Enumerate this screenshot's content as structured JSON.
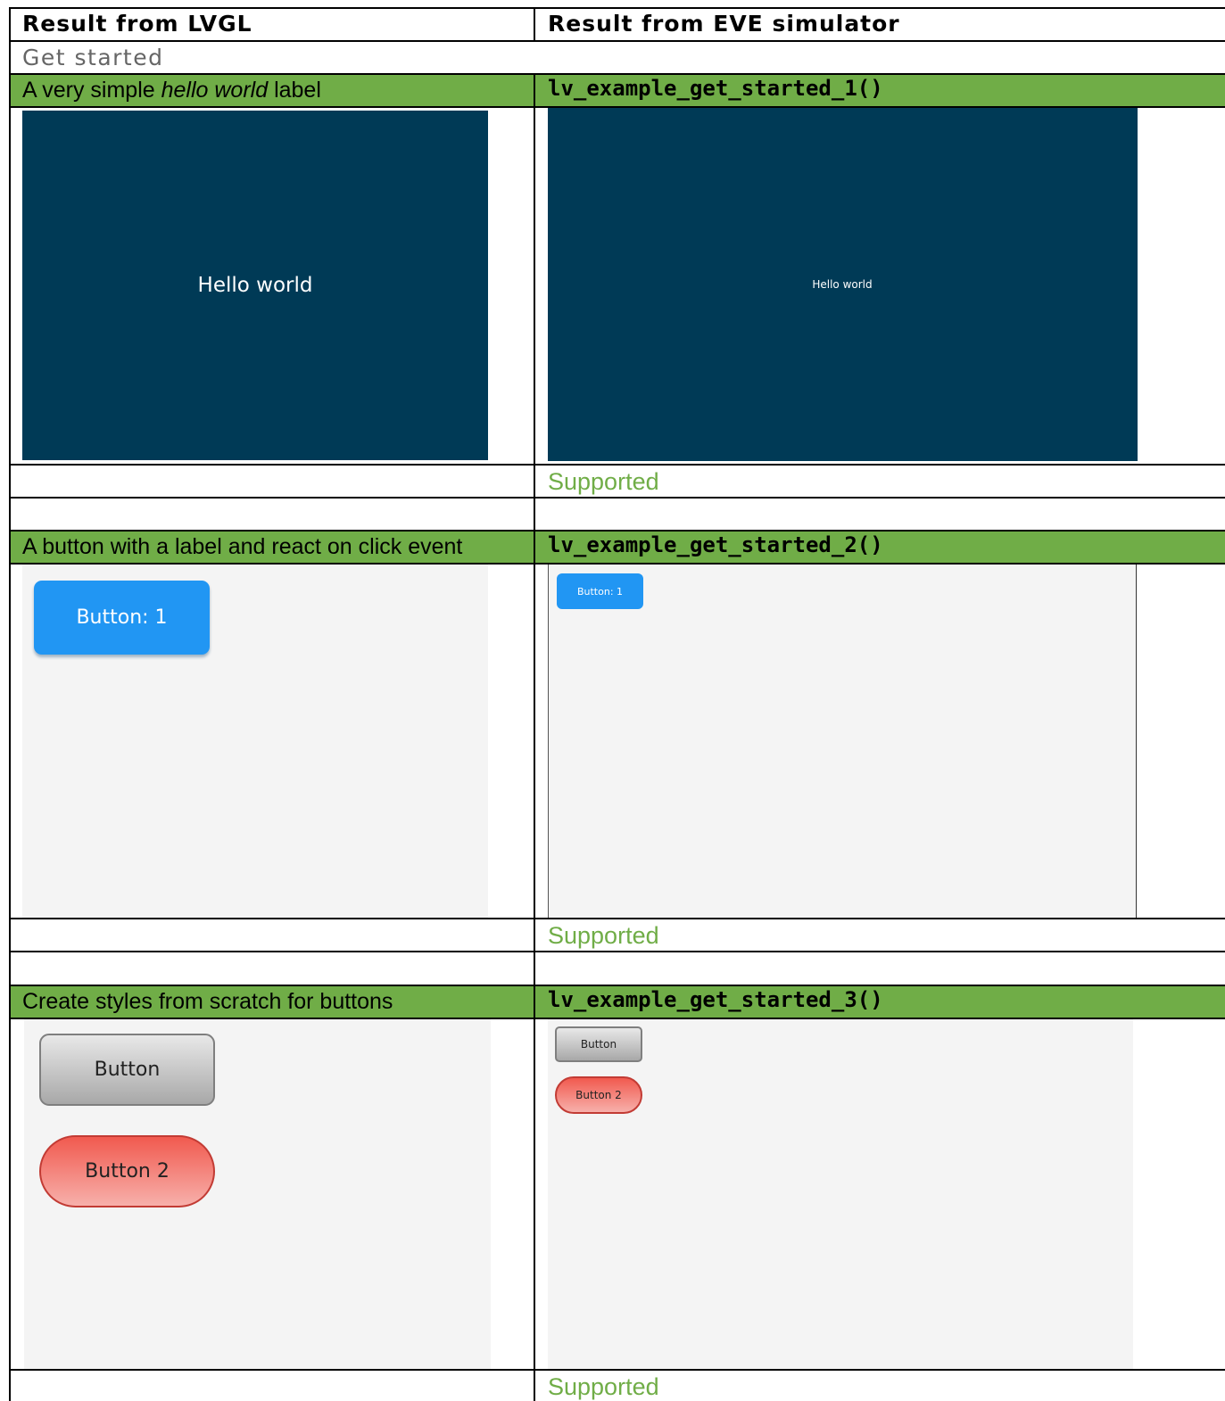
{
  "header": {
    "col_left": "Result from LVGL",
    "col_right": "Result from EVE simulator"
  },
  "section": {
    "title": "Get started"
  },
  "examples": [
    {
      "desc_pre": "A very simple ",
      "desc_em": "hello world",
      "desc_post": " label",
      "code": "lv_example_get_started_1()",
      "lvgl_label": "Hello world",
      "eve_label": "Hello world",
      "status": "Supported",
      "colors": {
        "background": "#003a56"
      }
    },
    {
      "desc": "A button with a label and react on click event",
      "code": "lv_example_get_started_2()",
      "lvgl_button": "Button: 1",
      "eve_button": "Button: 1",
      "status": "Supported",
      "colors": {
        "button": "#2196f3",
        "background": "#f4f4f4"
      }
    },
    {
      "desc": "Create styles from scratch for buttons",
      "code": "lv_example_get_started_3()",
      "lvgl_button_1": "Button",
      "lvgl_button_2": "Button 2",
      "eve_button_1": "Button",
      "eve_button_2": "Button 2",
      "status": "Supported",
      "colors": {
        "button_1": "#bdbdbd",
        "button_2": "#f26b63",
        "background": "#f4f4f4"
      }
    }
  ],
  "colors": {
    "row_highlight": "#70ad47",
    "status_text": "#70ad47",
    "section_text": "#666666"
  }
}
